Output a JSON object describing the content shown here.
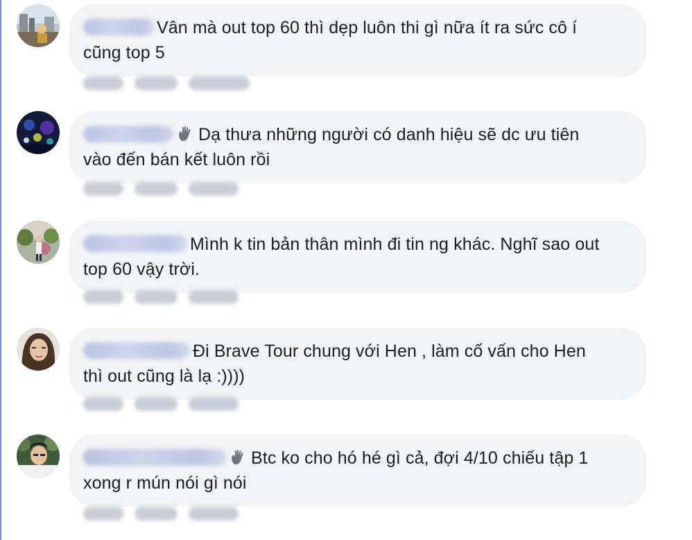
{
  "comments": [
    {
      "avatar": "avatar-city",
      "text_line1": "Vân mà out top 60 thì dẹp luôn thi gì nữa ít ra sức cô í",
      "text_line2": "cũng top 5",
      "has_wave_icon": false
    },
    {
      "avatar": "avatar-night-lights",
      "text_line1": "Dạ thưa những người có danh hiệu sẽ dc ưu tiên",
      "text_line2": "vào đến bán kết luôn rồi",
      "has_wave_icon": true
    },
    {
      "avatar": "avatar-garden",
      "text_line1": "Mình k tin bản thân mình đi tin ng khác. Nghĩ sao out",
      "text_line2": "top 60 vậy trời.",
      "has_wave_icon": false
    },
    {
      "avatar": "avatar-woman",
      "text_line1": "Đi Brave Tour chung với Hen , làm cố vấn cho Hen",
      "text_line2": "thì out cũng là lạ :))))",
      "has_wave_icon": false
    },
    {
      "avatar": "avatar-man",
      "text_line1": "Btc ko cho hó hé gì cả, đợi 4/10 chiếu tập 1",
      "text_line2": "xong r mún nói gì nói",
      "has_wave_icon": true
    }
  ],
  "colors": {
    "bubble_background": "#f2f3f5",
    "text": "#1c1e21",
    "blurred_name": "#bcc6e3",
    "blurred_actions": "#c9cdd6",
    "left_border": "#6d8fd6"
  }
}
